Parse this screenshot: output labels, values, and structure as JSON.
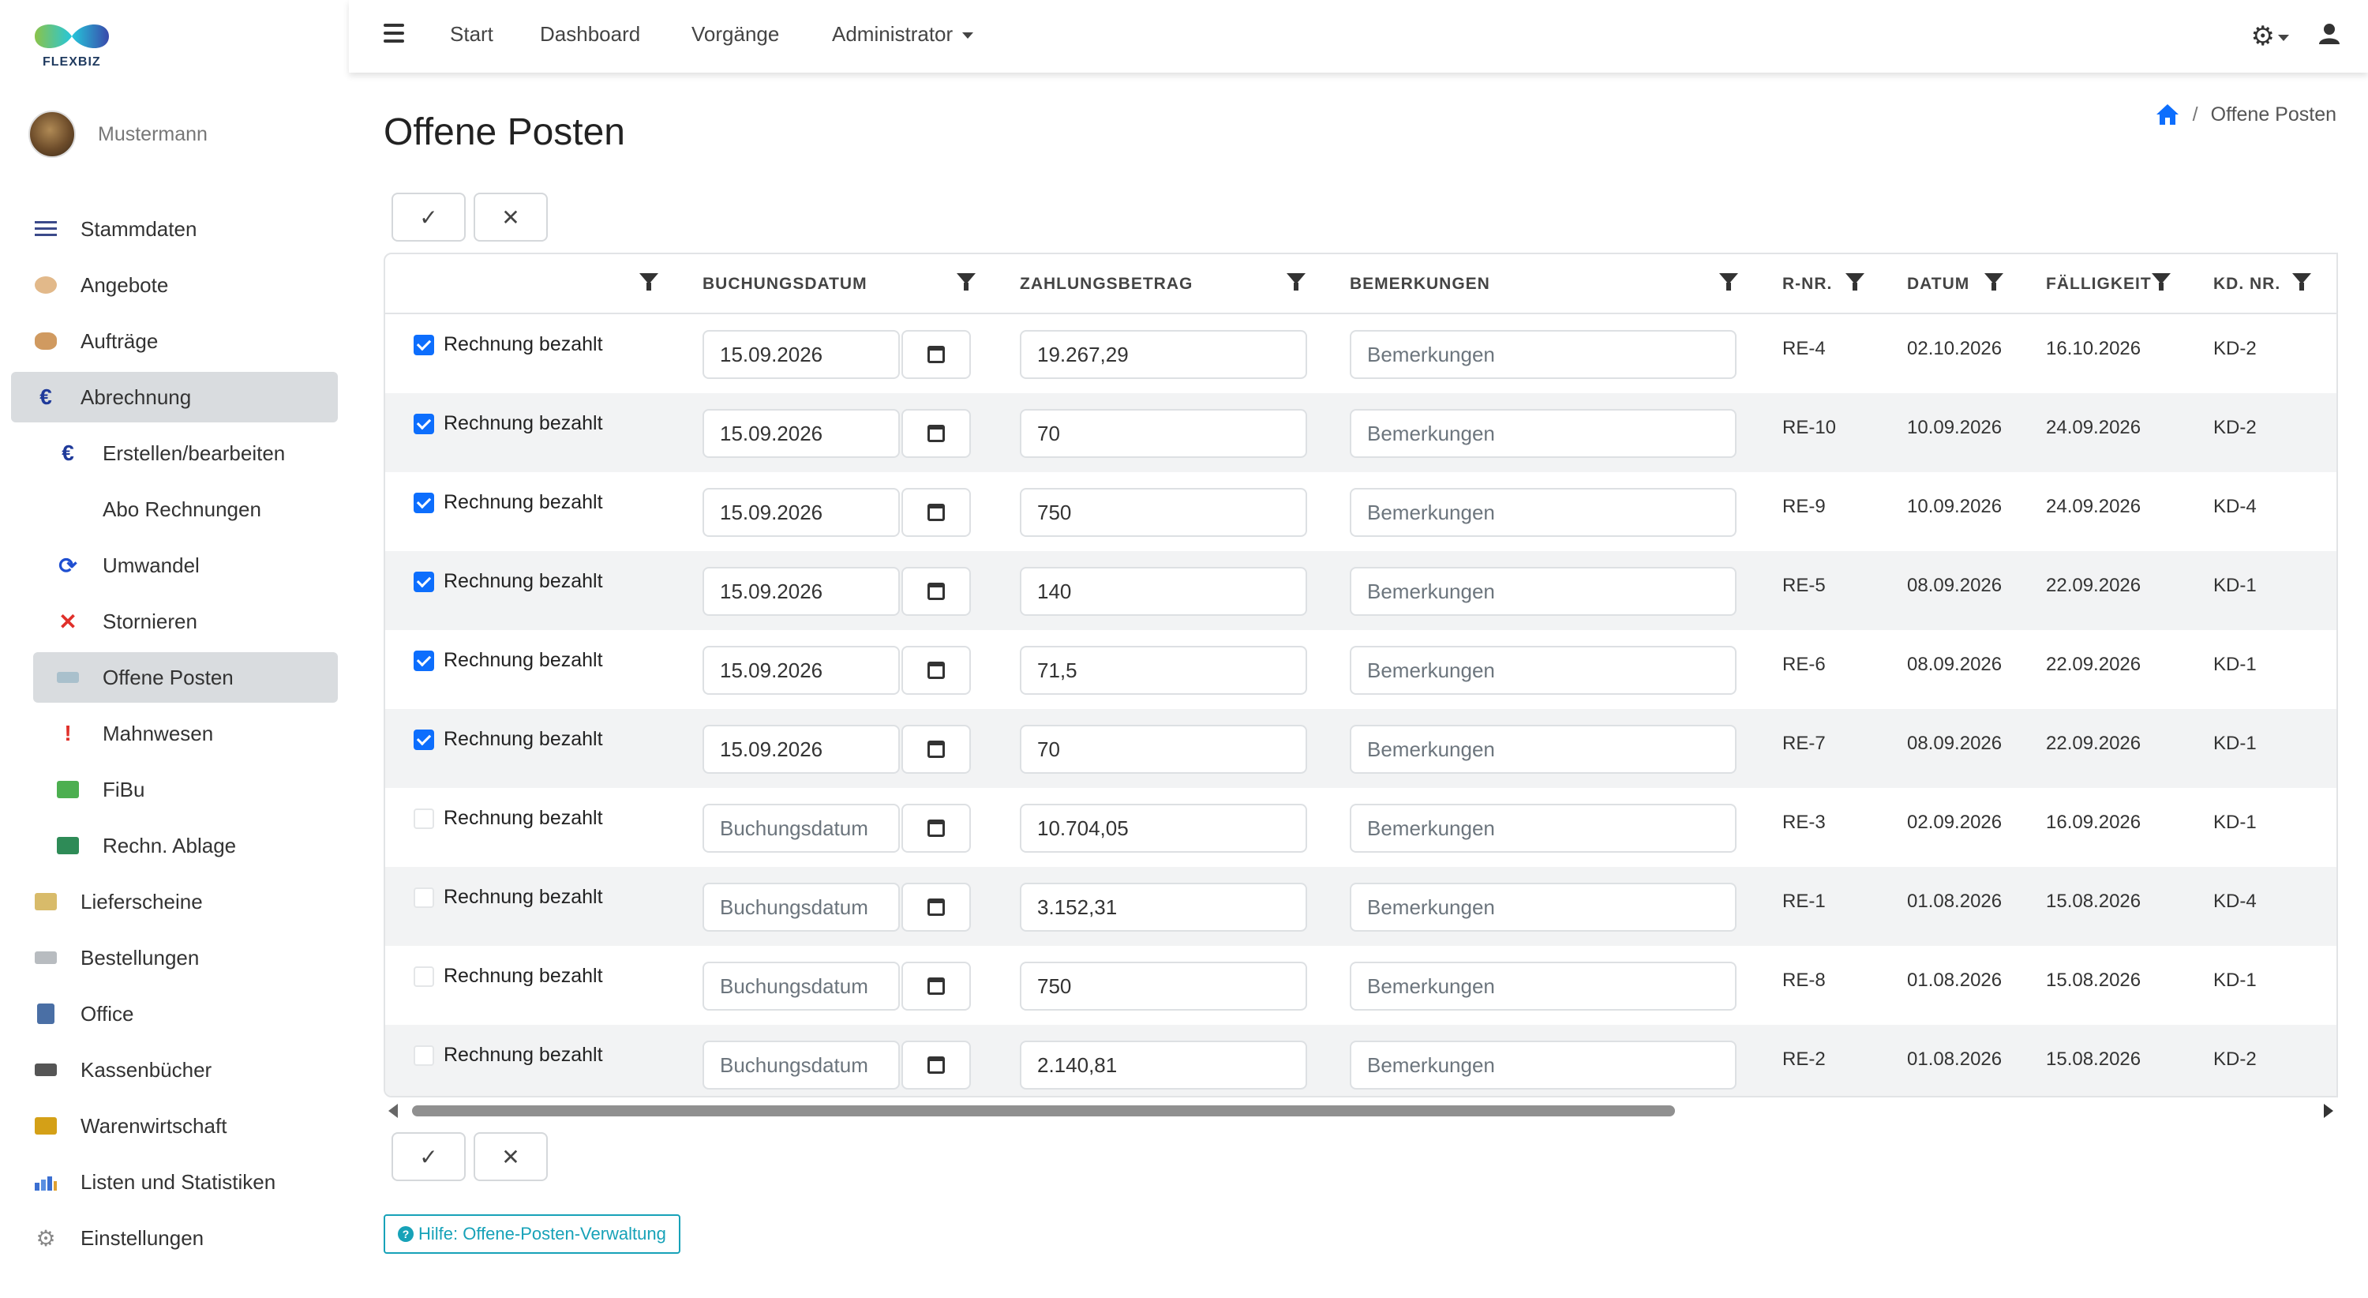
{
  "brand": {
    "name": "FLEXBIZ"
  },
  "user": {
    "name": "Mustermann"
  },
  "sidebar": {
    "items": [
      {
        "label": "Stammdaten",
        "icon": "list-icon",
        "color": "#3b4a8a"
      },
      {
        "label": "Angebote",
        "icon": "handshake-icon",
        "color": "#d9a46a"
      },
      {
        "label": "Aufträge",
        "icon": "hands-icon",
        "color": "#c98a4a"
      },
      {
        "label": "Abrechnung",
        "icon": "euro-icon",
        "color": "#1f3a9a"
      },
      {
        "label": "Erstellen/bearbeiten",
        "icon": "euro-icon",
        "color": "#1f3a9a"
      },
      {
        "label": "Abo Rechnungen",
        "icon": "",
        "color": ""
      },
      {
        "label": "Umwandel",
        "icon": "refresh-icon",
        "color": "#1f4fd1"
      },
      {
        "label": "Stornieren",
        "icon": "cross-icon",
        "color": "#e0302a"
      },
      {
        "label": "Offene Posten",
        "icon": "cash-icon",
        "color": "#7fa0b0"
      },
      {
        "label": "Mahnwesen",
        "icon": "exclamation-icon",
        "color": "#e0302a"
      },
      {
        "label": "FiBu",
        "icon": "datev-icon",
        "color": "#4caf50"
      },
      {
        "label": "Rechn. Ablage",
        "icon": "archive-icon",
        "color": "#2e8b57"
      },
      {
        "label": "Lieferscheine",
        "icon": "delivery-icon",
        "color": "#c9a54a"
      },
      {
        "label": "Bestellungen",
        "icon": "cart-icon",
        "color": "#9aa0a6"
      },
      {
        "label": "Office",
        "icon": "office-icon",
        "color": "#4a6fa5"
      },
      {
        "label": "Kassenbücher",
        "icon": "cashbox-icon",
        "color": "#555555"
      },
      {
        "label": "Warenwirtschaft",
        "icon": "forklift-icon",
        "color": "#d4a017"
      },
      {
        "label": "Listen und Statistiken",
        "icon": "stats-icon",
        "color": "#3b6fd1"
      },
      {
        "label": "Einstellungen",
        "icon": "gear-icon",
        "color": "#888888"
      }
    ]
  },
  "topnav": {
    "start": "Start",
    "dashboard": "Dashboard",
    "vorgaenge": "Vorgänge",
    "admin": "Administrator"
  },
  "page": {
    "title": "Offene Posten",
    "breadcrumb": "Offene Posten"
  },
  "toolbar": {
    "confirm": "✓",
    "cancel": "✕"
  },
  "table": {
    "headers": {
      "buchungsdatum": "BUCHUNGSDATUM",
      "zahlungsbetrag": "ZAHLUNGSBETRAG",
      "bemerkungen": "BEMERKUNGEN",
      "rnr": "R-NR.",
      "datum": "DATUM",
      "faelligkeit": "FÄLLIGKEIT",
      "kdnr": "KD. NR."
    },
    "placeholders": {
      "buchungsdatum": "Buchungsdatum",
      "bemerkungen": "Bemerkungen"
    },
    "rows": [
      {
        "paid": true,
        "label": "Rechnung bezahlt",
        "buchungsdatum": "15.09.2026",
        "betrag": "19.267,29",
        "rnr": "RE-4",
        "datum": "02.10.2026",
        "faellig": "16.10.2026",
        "kdnr": "KD-2"
      },
      {
        "paid": true,
        "label": "Rechnung bezahlt",
        "buchungsdatum": "15.09.2026",
        "betrag": "70",
        "rnr": "RE-10",
        "datum": "10.09.2026",
        "faellig": "24.09.2026",
        "kdnr": "KD-2"
      },
      {
        "paid": true,
        "label": "Rechnung bezahlt",
        "buchungsdatum": "15.09.2026",
        "betrag": "750",
        "rnr": "RE-9",
        "datum": "10.09.2026",
        "faellig": "24.09.2026",
        "kdnr": "KD-4"
      },
      {
        "paid": true,
        "label": "Rechnung bezahlt",
        "buchungsdatum": "15.09.2026",
        "betrag": "140",
        "rnr": "RE-5",
        "datum": "08.09.2026",
        "faellig": "22.09.2026",
        "kdnr": "KD-1"
      },
      {
        "paid": true,
        "label": "Rechnung bezahlt",
        "buchungsdatum": "15.09.2026",
        "betrag": "71,5",
        "rnr": "RE-6",
        "datum": "08.09.2026",
        "faellig": "22.09.2026",
        "kdnr": "KD-1"
      },
      {
        "paid": true,
        "label": "Rechnung bezahlt",
        "buchungsdatum": "15.09.2026",
        "betrag": "70",
        "rnr": "RE-7",
        "datum": "08.09.2026",
        "faellig": "22.09.2026",
        "kdnr": "KD-1"
      },
      {
        "paid": false,
        "label": "Rechnung bezahlt",
        "buchungsdatum": "",
        "betrag": "10.704,05",
        "rnr": "RE-3",
        "datum": "02.09.2026",
        "faellig": "16.09.2026",
        "kdnr": "KD-1"
      },
      {
        "paid": false,
        "label": "Rechnung bezahlt",
        "buchungsdatum": "",
        "betrag": "3.152,31",
        "rnr": "RE-1",
        "datum": "01.08.2026",
        "faellig": "15.08.2026",
        "kdnr": "KD-4"
      },
      {
        "paid": false,
        "label": "Rechnung bezahlt",
        "buchungsdatum": "",
        "betrag": "750",
        "rnr": "RE-8",
        "datum": "01.08.2026",
        "faellig": "15.08.2026",
        "kdnr": "KD-1"
      },
      {
        "paid": false,
        "label": "Rechnung bezahlt",
        "buchungsdatum": "",
        "betrag": "2.140,81",
        "rnr": "RE-2",
        "datum": "01.08.2026",
        "faellig": "15.08.2026",
        "kdnr": "KD-2"
      }
    ]
  },
  "help": {
    "label": "Hilfe: Offene-Posten-Verwaltung"
  },
  "colors": {
    "accent": "#0d6efd",
    "help": "#17a2b8",
    "active_bg": "#d9dcdf"
  }
}
